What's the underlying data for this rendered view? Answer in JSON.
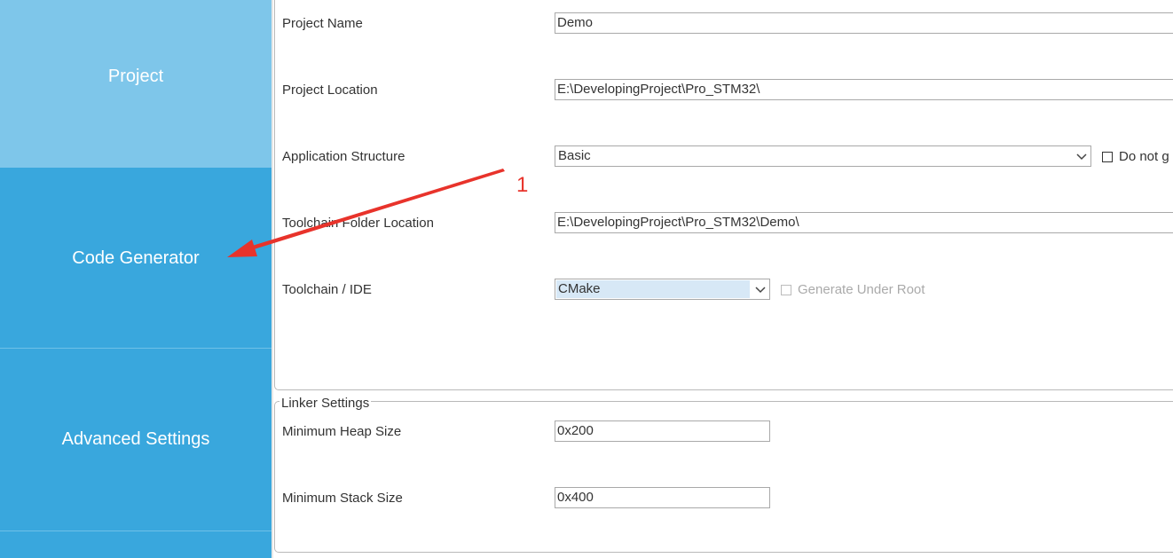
{
  "sidebar": {
    "items": [
      {
        "label": "Project"
      },
      {
        "label": "Code Generator"
      },
      {
        "label": "Advanced Settings"
      }
    ]
  },
  "project_settings": {
    "project_name_label": "Project Name",
    "project_name_value": "Demo",
    "project_location_label": "Project Location",
    "project_location_value": "E:\\DevelopingProject\\Pro_STM32\\",
    "app_structure_label": "Application Structure",
    "app_structure_value": "Basic",
    "do_not_generate_label": "Do not g",
    "toolchain_folder_label": "Toolchain Folder Location",
    "toolchain_folder_value": "E:\\DevelopingProject\\Pro_STM32\\Demo\\",
    "toolchain_ide_label": "Toolchain / IDE",
    "toolchain_ide_value": "CMake",
    "generate_under_root_label": "Generate Under Root"
  },
  "linker_settings": {
    "title": "Linker Settings",
    "min_heap_label": "Minimum Heap Size",
    "min_heap_value": "0x200",
    "min_stack_label": "Minimum Stack Size",
    "min_stack_value": "0x400"
  },
  "annotation": {
    "number": "1",
    "color": "#e8332b"
  },
  "colors": {
    "sidebar_active": "#39a7dd",
    "sidebar_light": "#7ec6ea"
  },
  "icons": {
    "dropdown": "chevron-down-icon",
    "annotation": "red-arrow"
  }
}
